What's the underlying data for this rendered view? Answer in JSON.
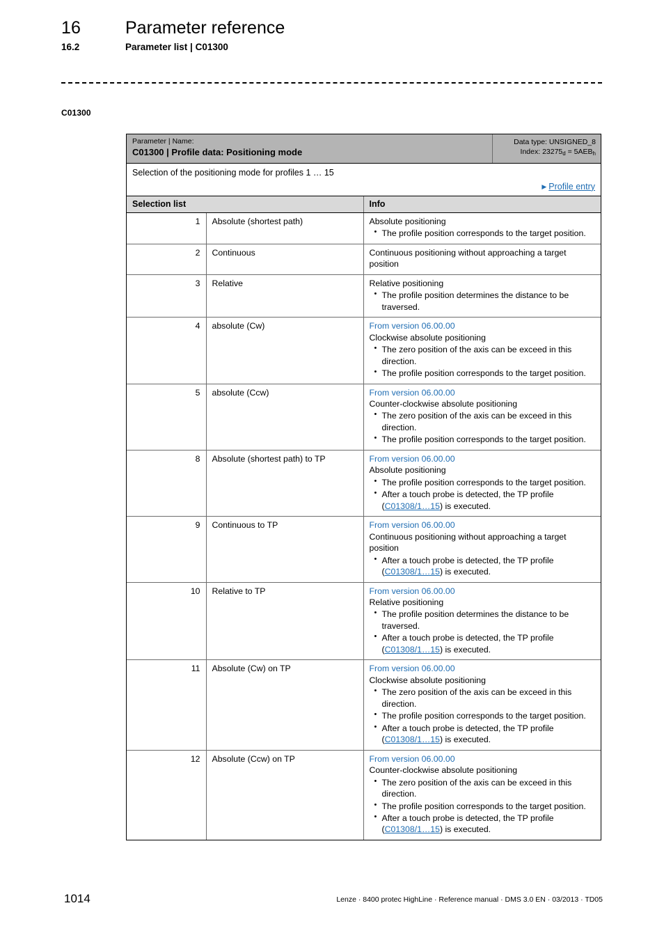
{
  "header": {
    "chapter_number": "16",
    "chapter_title": "Parameter reference",
    "section_number": "16.2",
    "section_title": "Parameter list | C01300"
  },
  "margin_label": "C01300",
  "parameter": {
    "head_label": "Parameter | Name:",
    "head_value": "C01300 | Profile data: Positioning mode",
    "data_type": "Data type: UNSIGNED_8",
    "index_prefix": "Index: 23275",
    "index_sub_dec": "d",
    "index_middle": " = 5AEB",
    "index_sub_hex": "h",
    "description": "Selection of the positioning mode for profiles 1 … 15",
    "related_link": "Profile entry",
    "triangle_glyph": "▶"
  },
  "table": {
    "col_selection_list": "Selection list",
    "col_info": "Info",
    "rows": [
      {
        "num": "1",
        "name": "Absolute (shortest path)",
        "version": "",
        "lead": "Absolute positioning",
        "bullets": [
          {
            "text": "The profile position corresponds to the target position.",
            "link": ""
          }
        ]
      },
      {
        "num": "2",
        "name": "Continuous",
        "version": "",
        "lead": "Continuous positioning without approaching a target position",
        "bullets": []
      },
      {
        "num": "3",
        "name": "Relative",
        "version": "",
        "lead": "Relative positioning",
        "bullets": [
          {
            "text": "The profile position determines the distance to be traversed.",
            "link": ""
          }
        ]
      },
      {
        "num": "4",
        "name": "absolute (Cw)",
        "version": "From version 06.00.00",
        "lead": "Clockwise absolute positioning",
        "bullets": [
          {
            "text": "The zero position of the axis can be exceed in this direction.",
            "link": ""
          },
          {
            "text": "The profile position corresponds to the target position.",
            "link": ""
          }
        ]
      },
      {
        "num": "5",
        "name": "absolute (Ccw)",
        "version": "From version 06.00.00",
        "lead": "Counter-clockwise absolute positioning",
        "bullets": [
          {
            "text": "The zero position of the axis can be exceed in this direction.",
            "link": ""
          },
          {
            "text": "The profile position corresponds to the target position.",
            "link": ""
          }
        ]
      },
      {
        "num": "8",
        "name": "Absolute (shortest path) to TP",
        "version": "From version 06.00.00",
        "lead": "Absolute positioning",
        "bullets": [
          {
            "text": "The profile position corresponds to the target position.",
            "link": ""
          },
          {
            "pre": "After a touch probe is detected, the TP profile (",
            "link": "C01308/1…15",
            "post": ") is executed."
          }
        ]
      },
      {
        "num": "9",
        "name": "Continuous to TP",
        "version": "From version 06.00.00",
        "lead": "Continuous positioning without approaching a target position",
        "bullets": [
          {
            "pre": "After a touch probe is detected, the TP profile (",
            "link": "C01308/1…15",
            "post": ") is executed."
          }
        ]
      },
      {
        "num": "10",
        "name": "Relative to TP",
        "version": "From version 06.00.00",
        "lead": "Relative positioning",
        "bullets": [
          {
            "text": "The profile position determines the distance to be traversed.",
            "link": ""
          },
          {
            "pre": "After a touch probe is detected, the TP profile (",
            "link": "C01308/1…15",
            "post": ") is executed."
          }
        ]
      },
      {
        "num": "11",
        "name": "Absolute (Cw) on TP",
        "version": "From version 06.00.00",
        "lead": "Clockwise absolute positioning",
        "bullets": [
          {
            "text": "The zero position of the axis can be exceed in this direction.",
            "link": ""
          },
          {
            "text": "The profile position corresponds to the target position.",
            "link": ""
          },
          {
            "pre": "After a touch probe is detected, the TP profile (",
            "link": "C01308/1…15",
            "post": ") is executed."
          }
        ]
      },
      {
        "num": "12",
        "name": "Absolute (Ccw) on TP",
        "version": "From version 06.00.00",
        "lead": "Counter-clockwise absolute positioning",
        "bullets": [
          {
            "text": "The zero position of the axis can be exceed in this direction.",
            "link": ""
          },
          {
            "text": "The profile position corresponds to the target position.",
            "link": ""
          },
          {
            "pre": "After a touch probe is detected, the TP profile (",
            "link": "C01308/1…15",
            "post": ") is executed."
          }
        ]
      }
    ]
  },
  "footer": {
    "page_number": "1014",
    "document_info": "Lenze · 8400 protec HighLine · Reference manual · DMS 3.0 EN · 03/2013 · TD05"
  },
  "colors": {
    "link_blue": "#1f6db3",
    "head_gray": "#b4b4b4",
    "subhead_gray": "#d9d9d9"
  }
}
